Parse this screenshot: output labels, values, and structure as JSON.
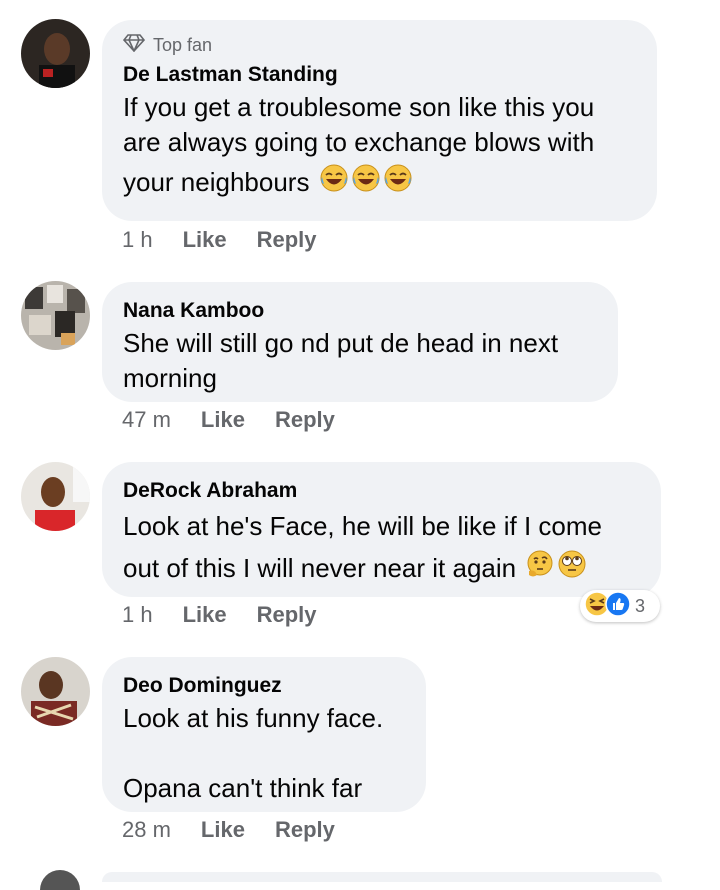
{
  "comments": [
    {
      "badge": "Top fan",
      "author": "De Lastman Standing",
      "text_lines": [
        "If you get a troublesome son like this you",
        "are always going to exchange blows with",
        "your neighbours"
      ],
      "emojis": [
        "tears-of-joy",
        "tears-of-joy",
        "tears-of-joy"
      ],
      "time": "1 h",
      "like": "Like",
      "reply": "Reply"
    },
    {
      "author": "Nana Kamboo",
      "text_lines": [
        "She will still go nd put de head in next",
        "morning"
      ],
      "time": "47 m",
      "like": "Like",
      "reply": "Reply"
    },
    {
      "author": "DeRock Abraham",
      "text_lines": [
        "Look at he's Face, he will be like if I come",
        "out of this I will never near it again"
      ],
      "emojis": [
        "thinking-face",
        "rolling-eyes"
      ],
      "time": "1 h",
      "like": "Like",
      "reply": "Reply",
      "reactions": {
        "icons": [
          "laughing-squint",
          "like-thumb"
        ],
        "count": "3"
      }
    },
    {
      "author": "Deo Dominguez",
      "text_lines": [
        "Look at his funny face.",
        "",
        "Opana can't think far"
      ],
      "time": "28 m",
      "like": "Like",
      "reply": "Reply"
    }
  ],
  "colors": {
    "bubble": "#f0f2f5",
    "meta": "#65676b",
    "text": "#050505",
    "like_blue": "#1877f2"
  }
}
